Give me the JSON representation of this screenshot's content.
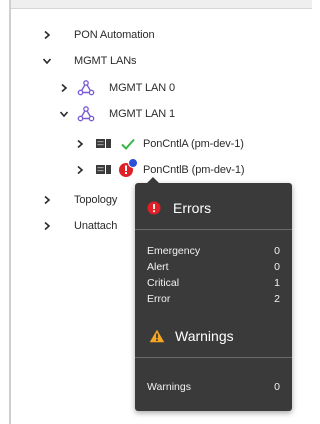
{
  "tree": {
    "items": [
      {
        "label": "PON Automation",
        "expanded": false
      },
      {
        "label": "MGMT LANs",
        "expanded": true
      },
      {
        "label": "MGMT LAN 0",
        "expanded": false
      },
      {
        "label": "MGMT LAN 1",
        "expanded": true
      },
      {
        "label": "PonCntlA (pm-dev-1)",
        "status": "ok"
      },
      {
        "label": "PonCntlB (pm-dev-1)",
        "status": "error"
      },
      {
        "label": "Topology",
        "expanded": false
      },
      {
        "label": "Unattach",
        "expanded": false
      }
    ]
  },
  "tooltip": {
    "errors_title": "Errors",
    "warnings_title": "Warnings",
    "errors": [
      {
        "label": "Emergency",
        "value": "0"
      },
      {
        "label": "Alert",
        "value": "0"
      },
      {
        "label": "Critical",
        "value": "1"
      },
      {
        "label": "Error",
        "value": "2"
      }
    ],
    "warnings": [
      {
        "label": "Warnings",
        "value": "0"
      }
    ]
  },
  "colors": {
    "error_red": "#e01f26",
    "ok_green": "#3bb54a",
    "warning_orange": "#f5a623",
    "badge_blue": "#2b4fd8",
    "lan_purple": "#7a5bd6",
    "tooltip_bg": "#3a3a3a"
  },
  "icons": {
    "chevron_right": "chevron-right-icon",
    "chevron_down": "chevron-down-icon",
    "lan": "network-lan-icon",
    "server": "server-icon",
    "ok": "checkmark-icon",
    "error": "error-icon",
    "warning": "warning-icon"
  }
}
